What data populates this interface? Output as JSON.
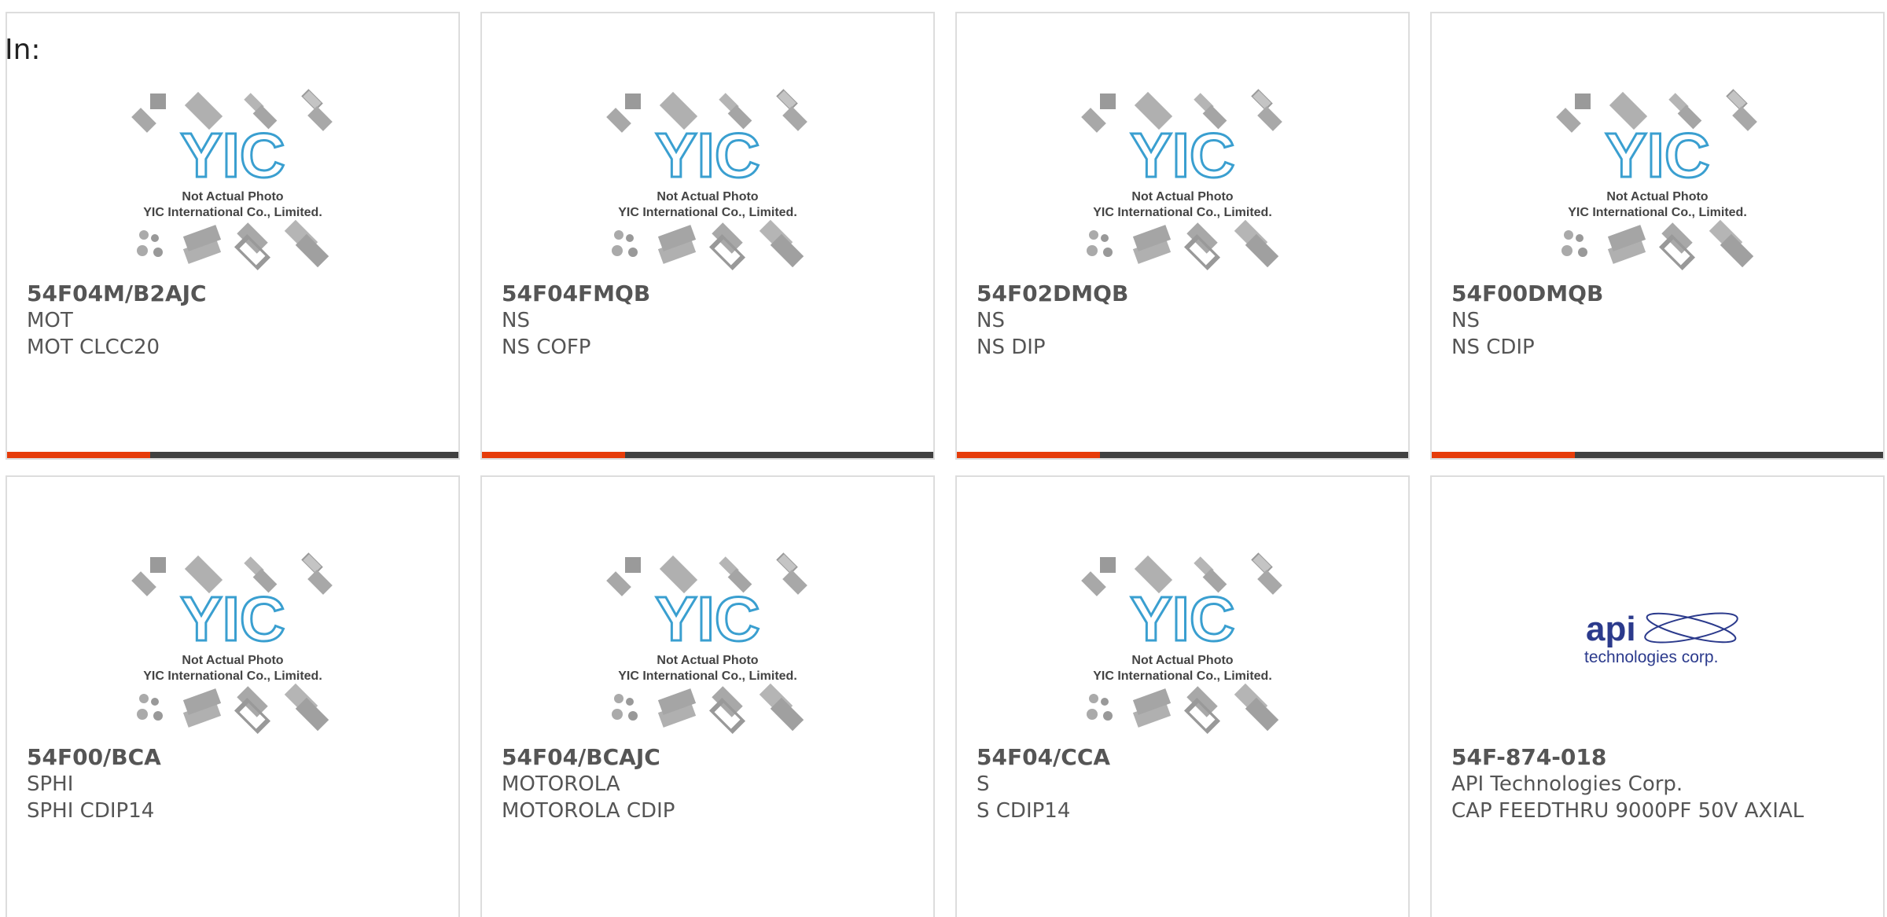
{
  "header": {
    "label": "In:"
  },
  "colors": {
    "accent": "#e63c0a",
    "bar": "#404040",
    "yic_logo": "#3a9fd0",
    "api_logo": "#2b3a8c"
  },
  "placeholder": {
    "logo_text": "YIC",
    "line1": "Not Actual Photo",
    "line2": "YIC International Co., Limited."
  },
  "api_logo": {
    "word": "api",
    "tagline": "technologies corp."
  },
  "products": [
    {
      "part": "54F04M/B2AJC",
      "maker": "MOT",
      "desc": "MOT CLCC20",
      "image": "yic-placeholder"
    },
    {
      "part": "54F04FMQB",
      "maker": "NS",
      "desc": "NS COFP",
      "image": "yic-placeholder"
    },
    {
      "part": "54F02DMQB",
      "maker": "NS",
      "desc": "NS DIP",
      "image": "yic-placeholder"
    },
    {
      "part": "54F00DMQB",
      "maker": "NS",
      "desc": "NS CDIP",
      "image": "yic-placeholder"
    },
    {
      "part": "54F00/BCA",
      "maker": "SPHI",
      "desc": "SPHI CDIP14",
      "image": "yic-placeholder"
    },
    {
      "part": "54F04/BCAJC",
      "maker": "MOTOROLA",
      "desc": "MOTOROLA CDIP",
      "image": "yic-placeholder"
    },
    {
      "part": "54F04/CCA",
      "maker": "S",
      "desc": "S CDIP14",
      "image": "yic-placeholder"
    },
    {
      "part": "54F-874-018",
      "maker": "API Technologies Corp.",
      "desc": "CAP FEEDTHRU 9000PF 50V AXIAL",
      "image": "api-logo"
    }
  ]
}
